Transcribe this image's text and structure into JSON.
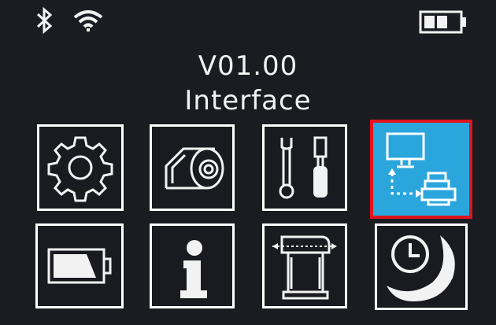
{
  "status_bar": {
    "icons": [
      "bluetooth-icon",
      "wifi-icon",
      "battery-icon"
    ],
    "battery_level": 0.67
  },
  "header": {
    "version": "V01.00",
    "title": "Interface"
  },
  "menu": {
    "selected": "interface",
    "tiles": [
      {
        "id": "settings",
        "icon": "gear-icon"
      },
      {
        "id": "media",
        "icon": "media-roll-icon"
      },
      {
        "id": "tools",
        "icon": "wrench-screwdriver-icon"
      },
      {
        "id": "interface",
        "icon": "computer-printer-connection-icon"
      },
      {
        "id": "power",
        "icon": "battery-icon"
      },
      {
        "id": "information",
        "icon": "info-icon"
      },
      {
        "id": "paper-calibration",
        "icon": "paper-feed-icon"
      },
      {
        "id": "sleep",
        "icon": "clock-moon-icon"
      }
    ]
  },
  "colors": {
    "background": "#1b1c22",
    "tile_border": "#ffffff",
    "selected_fill": "#2aa6dc",
    "selected_border": "#e0141e",
    "text": "#f2f2f2"
  }
}
